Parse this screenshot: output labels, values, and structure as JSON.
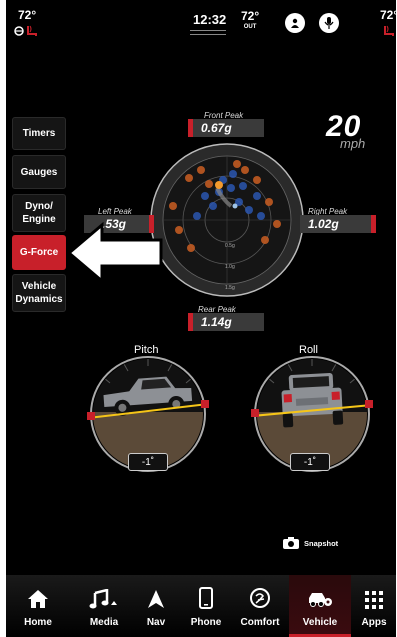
{
  "status_bar": {
    "left_temp": "72°",
    "right_temp": "72°",
    "time": "12:32",
    "outside_temp": "72°",
    "outside_label": "OUT"
  },
  "side_menu": {
    "items": [
      {
        "label": "Timers",
        "active": false
      },
      {
        "label": "Gauges",
        "active": false
      },
      {
        "label": "Dyno/ Engine",
        "active": false
      },
      {
        "label": "G-Force",
        "active": true
      },
      {
        "label": "Vehicle Dynamics",
        "active": false
      }
    ]
  },
  "speed": {
    "value": "20",
    "unit": "mph"
  },
  "gforce": {
    "front_peak": {
      "title": "Front Peak",
      "value": "0.67g"
    },
    "left_peak": {
      "title": "Left Peak",
      "value": ".53g"
    },
    "right_peak": {
      "title": "Right Peak",
      "value": "1.02g"
    },
    "rear_peak": {
      "title": "Rear Peak",
      "value": "1.14g"
    },
    "ring_labels": [
      "0.5g",
      "1.0g",
      "1.5g"
    ]
  },
  "pitch": {
    "label": "Pitch",
    "value": "-1˚"
  },
  "roll": {
    "label": "Roll",
    "value": "-1˚"
  },
  "snapshot_label": "Snapshot",
  "nav": [
    {
      "label": "Home",
      "icon": "home-icon"
    },
    {
      "label": "Media",
      "icon": "music-note-icon"
    },
    {
      "label": "Nav",
      "icon": "navigation-arrow-icon"
    },
    {
      "label": "Phone",
      "icon": "phone-icon"
    },
    {
      "label": "Comfort",
      "icon": "comfort-icon"
    },
    {
      "label": "Vehicle",
      "icon": "vehicle-icon",
      "active": true
    },
    {
      "label": "Apps",
      "icon": "apps-grid-icon"
    }
  ],
  "colors": {
    "accent": "#c8202a",
    "background": "#000000",
    "scale_line": "#f5c518"
  }
}
